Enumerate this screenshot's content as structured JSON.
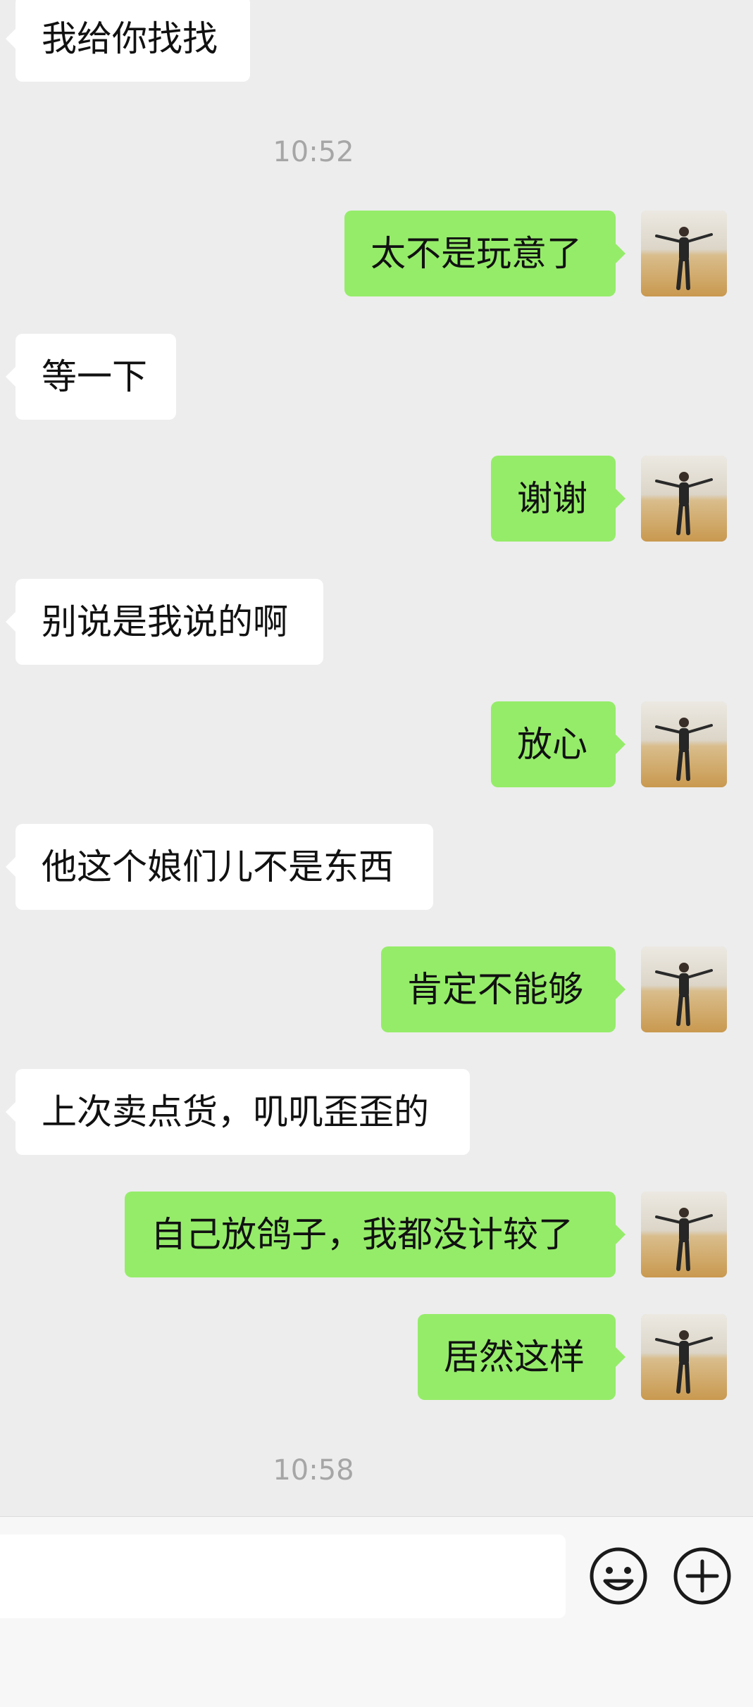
{
  "messages": [
    {
      "side": "in",
      "text": "我给你找找"
    },
    {
      "side": "time",
      "text": "10:52"
    },
    {
      "side": "out",
      "text": "太不是玩意了"
    },
    {
      "side": "in",
      "text": "等一下"
    },
    {
      "side": "out",
      "text": "谢谢"
    },
    {
      "side": "in",
      "text": "别说是我说的啊"
    },
    {
      "side": "out",
      "text": "放心"
    },
    {
      "side": "in",
      "text": "他这个娘们儿不是东西"
    },
    {
      "side": "out",
      "text": "肯定不能够"
    },
    {
      "side": "in",
      "text": "上次卖点货，叽叽歪歪的"
    },
    {
      "side": "out",
      "text": "自己放鸽子，我都没计较了"
    },
    {
      "side": "out",
      "text": "居然这样"
    },
    {
      "side": "time",
      "text": "10:58"
    }
  ],
  "input_bar": {
    "placeholder": "",
    "emoji_icon": "smiley-face-icon",
    "plus_icon": "plus-circle-icon"
  },
  "colors": {
    "background": "#ededed",
    "incoming_bubble": "#ffffff",
    "outgoing_bubble": "#95ec69",
    "timestamp": "#a6a6a6"
  }
}
